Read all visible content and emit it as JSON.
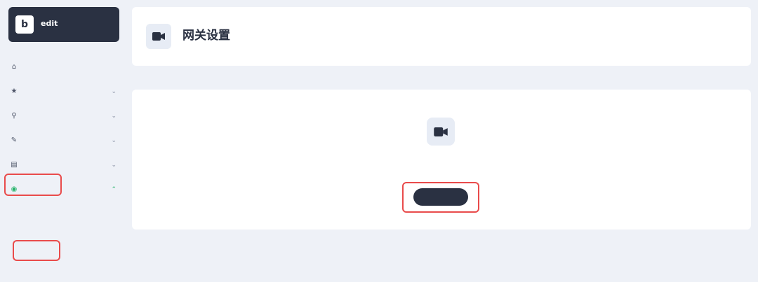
{
  "brand": {
    "name": "edit",
    "subtitle": "",
    "logo_letter": "b"
  },
  "nav": {
    "items": [
      {
        "label": "",
        "icon": "home-icon",
        "glyph": "⌂",
        "has_chevron": false,
        "active": false
      },
      {
        "label": "",
        "icon": "star-icon",
        "glyph": "★",
        "has_chevron": true,
        "active": false
      },
      {
        "label": "",
        "icon": "filter-icon",
        "glyph": "⚲",
        "has_chevron": true,
        "active": false
      },
      {
        "label": "",
        "icon": "edit-icon",
        "glyph": "✎",
        "has_chevron": true,
        "active": false
      },
      {
        "label": "",
        "icon": "chart-icon",
        "glyph": "▤",
        "has_chevron": true,
        "active": false
      },
      {
        "label": "",
        "icon": "gateway-icon",
        "glyph": "◉",
        "has_chevron": true,
        "active": true
      }
    ],
    "sub_items": [
      {
        "label": "",
        "active": false
      },
      {
        "label": "",
        "active": false
      },
      {
        "label": "",
        "active": false
      },
      {
        "label": "",
        "active": true
      },
      {
        "label": "",
        "active": false
      }
    ]
  },
  "header": {
    "title": "网关设置",
    "description": "",
    "icon": "camera-icon"
  },
  "section": {
    "label": ""
  },
  "empty_state": {
    "icon": "camera-icon",
    "title": "",
    "description": "",
    "button_label": ""
  },
  "colors": {
    "dark": "#2a3142",
    "accent": "#27b36b",
    "highlight": "#e94b4b",
    "background": "#eef1f7"
  }
}
